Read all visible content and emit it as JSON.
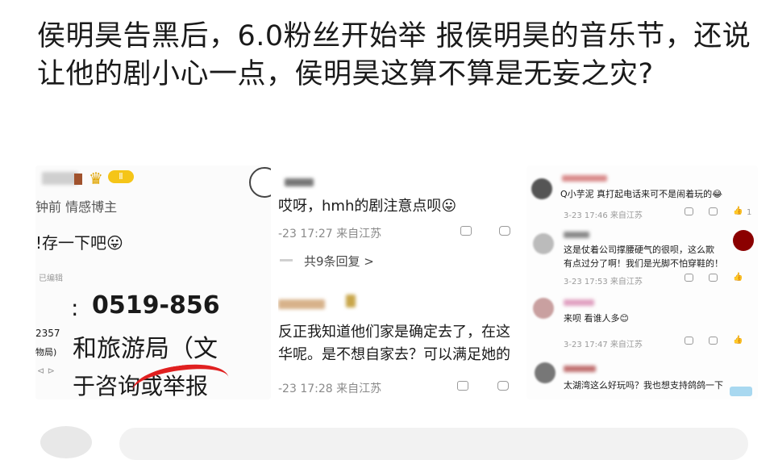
{
  "post": {
    "title": "侯明昊告黑后，6.0粉丝开始举 报侯明昊的音乐节，还说让他的剧小心一点，侯明昊这算不算是无妄之灾?"
  },
  "panel1": {
    "badge": "Ⅱ",
    "meta": "钟前  情感博主",
    "comment": "!存一下吧😛",
    "edited": "已编辑",
    "phone_prefix": ":",
    "phone": "0519-856",
    "num_left": "2357",
    "org_left": "物局)",
    "bureau": "和旅游局（文",
    "icons": "⊲  ⊳",
    "consult": "于咨询或举报"
  },
  "panel2": {
    "c1_text": "哎呀，hmh的剧注意点呗😛",
    "c1_time": "-23 17:27  来自江苏",
    "replies": "共9条回复 >",
    "c2_text1": "反正我知道他们家是确定去了，在这",
    "c2_text2": "华呢。是不想自家去？可以满足她的",
    "c2_time": "-23 17:28  来自江苏"
  },
  "panel3": {
    "c1_text": "Q小芋泥  真打起电话来可不是闹着玩的😂",
    "c1_time": "3-23 17:46  来自江苏",
    "c1_like": "1",
    "c2_text1": "这是仗着公司撑腰硬气的很呗，这么欺",
    "c2_text2": "有点过分了啊！我们是光脚不怕穿鞋的！",
    "c2_time": "3-23 17:53  来自江苏",
    "c3_text": "来呗 看谁人多😊",
    "c3_time": "3-23 17:47  来自江苏",
    "c4_text": "太湖湾这么好玩吗？我也想支持鸽鸽一下"
  }
}
